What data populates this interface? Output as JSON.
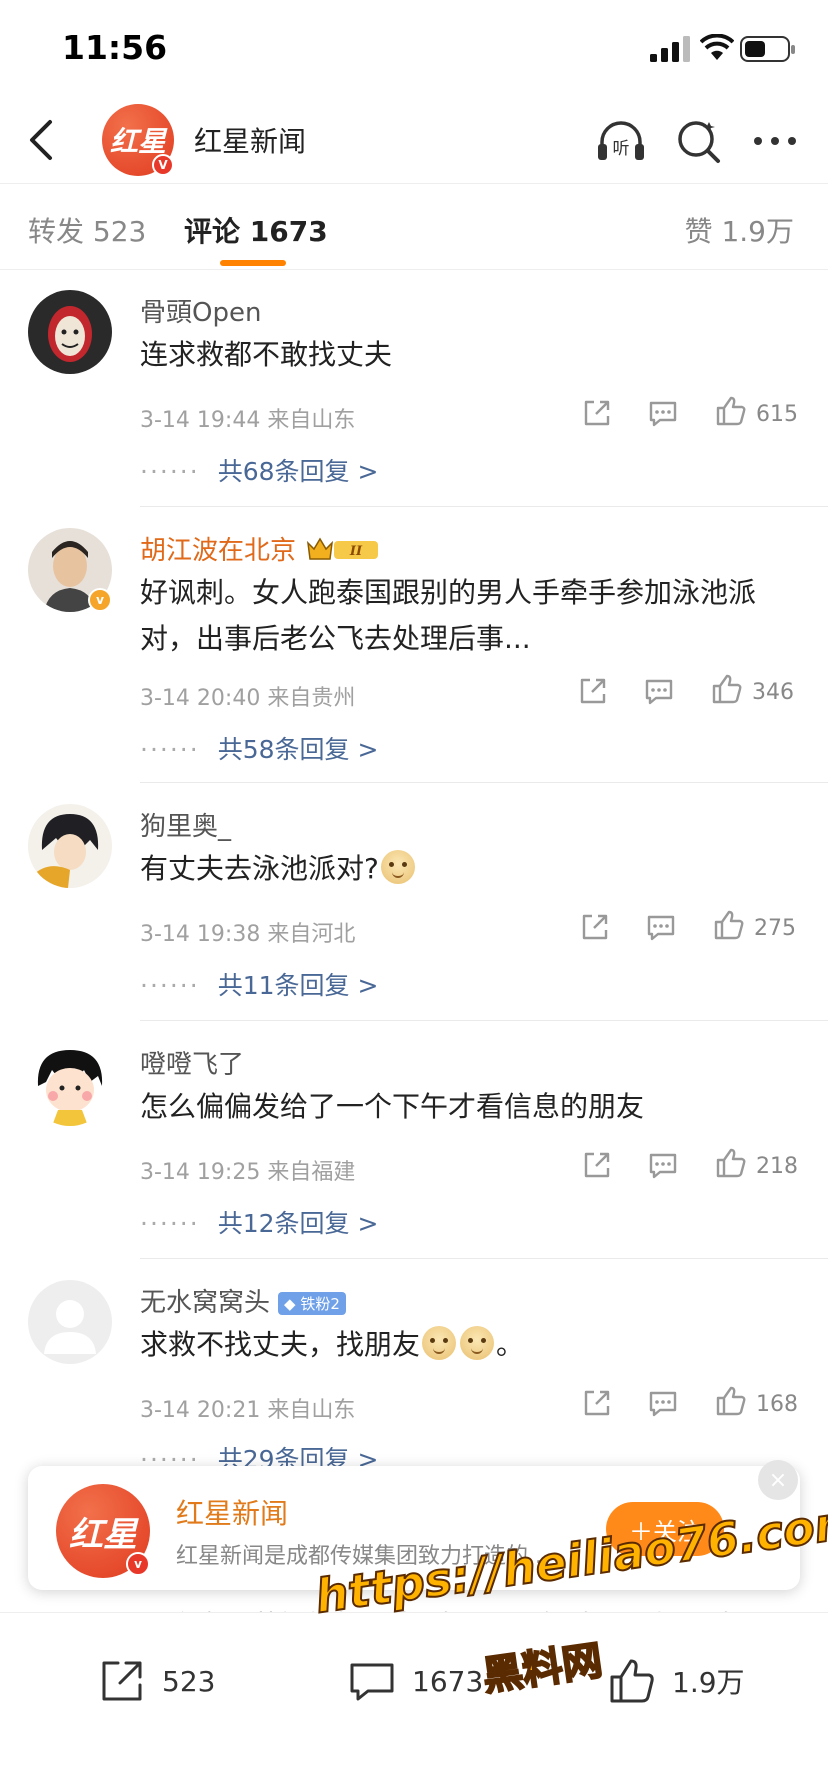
{
  "status_bar": {
    "time": "11:56"
  },
  "header": {
    "account_name": "红星新闻",
    "logo_text": "红星",
    "icons": [
      "back-arrow-icon",
      "listen-icon",
      "search-icon",
      "more-icon"
    ],
    "listen_label": "听"
  },
  "tabs": [
    {
      "label": "转发 523",
      "active": false
    },
    {
      "label": "评论 1673",
      "active": true
    },
    {
      "label": "赞 1.9万",
      "active": false
    }
  ],
  "comments": [
    {
      "user": "骨頭Open",
      "text": "连求救都不敢找丈夫",
      "meta": "3-14 19:44  来自山东",
      "likes": "615",
      "replies": "共68条回复 >"
    },
    {
      "user": "胡江波在北京",
      "badge": "II",
      "text": "好讽刺。女人跑泰国跟别的男人手牵手参加泳池派对，出事后老公飞去处理后事...",
      "meta": "3-14 20:40  来自贵州",
      "likes": "346",
      "replies": "共58条回复 >"
    },
    {
      "user": "狗里奥_",
      "text": "有丈夫去泳池派对?",
      "meta": "3-14 19:38  来自河北",
      "likes": "275",
      "replies": "共11条回复 >"
    },
    {
      "user": "噔噔飞了",
      "text": "怎么偏偏发给了一个下午才看信息的朋友",
      "meta": "3-14 19:25  来自福建",
      "likes": "218",
      "replies": "共12条回复 >"
    },
    {
      "user": "无水窝窝头",
      "badge": "铁粉2",
      "text_a": "求救不找丈夫，找朋友",
      "text_b": "。",
      "meta": "3-14 20:21  来自山东",
      "likes": "168",
      "replies": "共29条回复 >"
    }
  ],
  "reply_dots": "······",
  "follow_card": {
    "name": "红星新闻",
    "description": "红星新闻是成都传媒集团致力打造的...",
    "follow_label": "＋关注",
    "close_label": "×"
  },
  "peek_text": "一个字，英门门门   质疑降词，理解降词，加入降词",
  "bottom_bar": {
    "repost": "523",
    "comment": "1673",
    "like": "1.9万"
  },
  "watermark": {
    "line1": "https://heiliao76.com",
    "line2": "黑料网"
  },
  "colors": {
    "accent": "#ff8200",
    "link": "#4a6896",
    "vip_name": "#e06a1a"
  }
}
